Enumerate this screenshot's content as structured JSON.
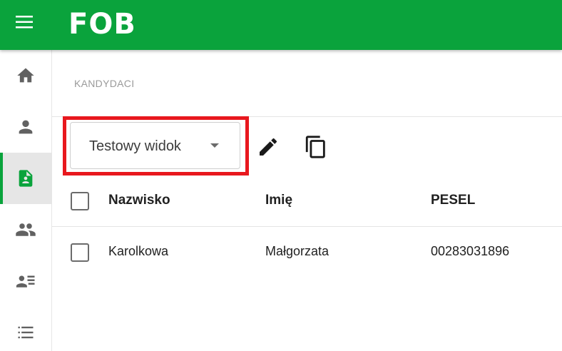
{
  "app": {
    "logo_text": "FOB",
    "brand_color": "#0aa33c",
    "highlight_color": "#e8181e"
  },
  "header": {
    "menu_icon": "hamburger-menu-icon"
  },
  "sidebar": {
    "items": [
      {
        "name": "home",
        "icon": "home-icon",
        "active": false
      },
      {
        "name": "person",
        "icon": "person-icon",
        "active": false
      },
      {
        "name": "candidate-file",
        "icon": "person-file-icon",
        "active": true
      },
      {
        "name": "people",
        "icon": "people-icon",
        "active": false
      },
      {
        "name": "contact-list",
        "icon": "person-list-icon",
        "active": false
      },
      {
        "name": "list",
        "icon": "list-icon",
        "active": false
      }
    ]
  },
  "main": {
    "section_title": "KANDYDACI",
    "view_select": {
      "selected": "Testowy widok",
      "caret_icon": "caret-down-icon"
    },
    "toolbar": {
      "edit_icon": "pencil-icon",
      "copy_icon": "copy-icon"
    },
    "table": {
      "columns": [
        "Nazwisko",
        "Imię",
        "PESEL"
      ],
      "rows": [
        {
          "nazwisko": "Karolkowa",
          "imie": "Małgorzata",
          "pesel": "00283031896"
        }
      ]
    }
  }
}
